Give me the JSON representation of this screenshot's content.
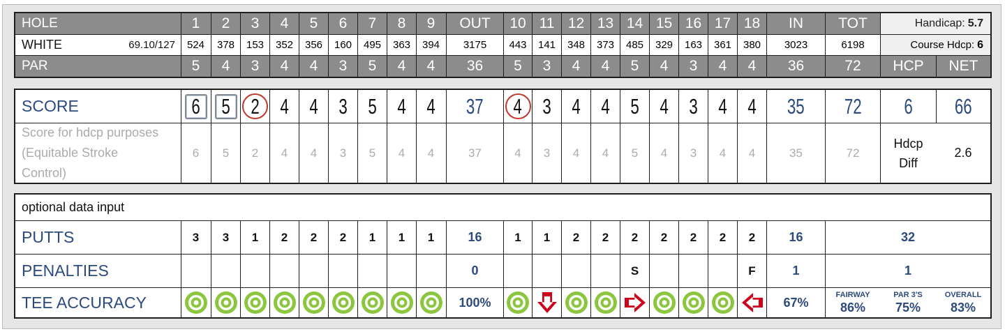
{
  "header": {
    "hole_label": "HOLE",
    "tee_label": "WHITE",
    "rating": "69.10/127",
    "par_label": "PAR",
    "holes_front": [
      "1",
      "2",
      "3",
      "4",
      "5",
      "6",
      "7",
      "8",
      "9"
    ],
    "holes_back": [
      "10",
      "11",
      "12",
      "13",
      "14",
      "15",
      "16",
      "17",
      "18"
    ],
    "out_label": "OUT",
    "in_label": "IN",
    "tot_label": "TOT",
    "yards_front": [
      "524",
      "378",
      "153",
      "352",
      "356",
      "160",
      "495",
      "363",
      "394"
    ],
    "yards_out": "3175",
    "yards_back": [
      "443",
      "141",
      "348",
      "373",
      "485",
      "329",
      "163",
      "361",
      "380"
    ],
    "yards_in": "3023",
    "yards_tot": "6198",
    "par_front": [
      "5",
      "4",
      "3",
      "4",
      "4",
      "3",
      "5",
      "4",
      "4"
    ],
    "par_out": "36",
    "par_back": [
      "5",
      "3",
      "4",
      "4",
      "5",
      "4",
      "3",
      "4",
      "4"
    ],
    "par_in": "36",
    "par_tot": "72",
    "handicap_label": "Handicap:",
    "handicap_value": "5.7",
    "course_hdcp_label": "Course Hdcp:",
    "course_hdcp_value": "6",
    "hcp_label": "HCP",
    "net_label": "NET"
  },
  "score": {
    "label": "SCORE",
    "front": [
      "6",
      "5",
      "2",
      "4",
      "4",
      "3",
      "5",
      "4",
      "4"
    ],
    "out": "37",
    "back": [
      "4",
      "3",
      "4",
      "4",
      "5",
      "4",
      "3",
      "4",
      "4"
    ],
    "in": "35",
    "tot": "72",
    "hcp": "6",
    "net": "66",
    "marks_front": [
      "square",
      "square",
      "circle",
      "",
      "",
      "",
      "",
      "",
      ""
    ],
    "marks_back": [
      "circle",
      "",
      "",
      "",
      "",
      "",
      "",
      "",
      ""
    ]
  },
  "hdcp_score": {
    "label_lines": [
      "Score for hdcp purposes",
      "(Equitable Stroke",
      "Control)"
    ],
    "front": [
      "6",
      "5",
      "2",
      "4",
      "4",
      "3",
      "5",
      "4",
      "4"
    ],
    "out": "37",
    "back": [
      "4",
      "3",
      "4",
      "4",
      "5",
      "4",
      "3",
      "4",
      "4"
    ],
    "in": "35",
    "tot": "72",
    "diff_label_lines": [
      "Hdcp",
      "Diff"
    ],
    "diff_value": "2.6"
  },
  "optional": {
    "title": "optional data input",
    "putts": {
      "label": "PUTTS",
      "front": [
        "3",
        "3",
        "1",
        "2",
        "2",
        "2",
        "1",
        "1",
        "1"
      ],
      "out": "16",
      "back": [
        "1",
        "1",
        "2",
        "2",
        "2",
        "2",
        "2",
        "2",
        "2"
      ],
      "in": "16",
      "total": "32"
    },
    "penalties": {
      "label": "PENALTIES",
      "front": [
        "",
        "",
        "",
        "",
        "",
        "",
        "",
        "",
        ""
      ],
      "out": "0",
      "back": [
        "",
        "",
        "",
        "",
        "S",
        "",
        "",
        "",
        "F"
      ],
      "in": "1",
      "total": "1"
    },
    "tee_accuracy": {
      "label": "TEE ACCURACY",
      "front": [
        "hit-fairway-icon",
        "hit-fairway-icon",
        "hit-fairway-icon",
        "hit-fairway-icon",
        "hit-fairway-icon",
        "hit-fairway-icon",
        "hit-fairway-icon",
        "hit-fairway-icon",
        "hit-fairway-icon"
      ],
      "out": "100%",
      "back": [
        "hit-fairway-icon",
        "miss-short-icon",
        "hit-fairway-icon",
        "hit-fairway-icon",
        "miss-right-icon",
        "hit-fairway-icon",
        "hit-fairway-icon",
        "hit-fairway-icon",
        "miss-left-icon"
      ],
      "in": "67%",
      "fairway_label": "FAIRWAY",
      "fairway_value": "86%",
      "par3_label": "PAR 3'S",
      "par3_value": "75%",
      "overall_label": "OVERALL",
      "overall_value": "83%"
    }
  },
  "colors": {
    "header_grey": "#8c8c8c",
    "score_blue": "#2c4a7c",
    "birdie_ring": "#c0392b",
    "bogey_square": "#7f8a99",
    "fairway_green": "#8cc63f",
    "miss_red": "#d0021b",
    "muted_text": "#ababab"
  }
}
